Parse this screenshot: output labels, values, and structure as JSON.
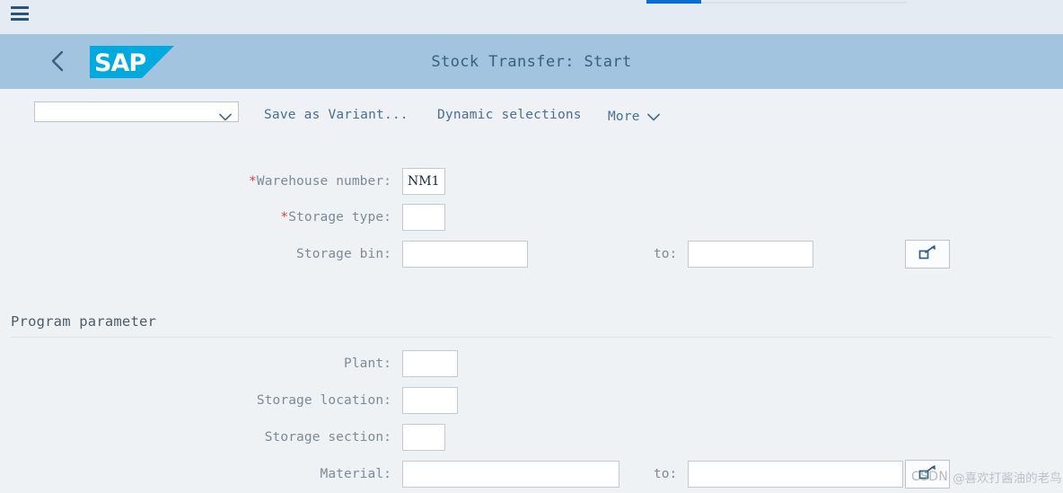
{
  "shell": {
    "menu_icon": "hamburger-menu-icon",
    "back_icon": "chevron-left-icon",
    "logo_text": "SAP",
    "title": "Stock Transfer: Start",
    "header_color": "#a3c4de",
    "accent_color": "#0a6ed1"
  },
  "toolbar": {
    "variant_value": "",
    "variant_placeholder": "",
    "variant_chevron_icon": "chevron-down-icon",
    "save_as_variant_label": "Save as Variant...",
    "dynamic_selections_label": "Dynamic selections",
    "more_label": "More",
    "more_chevron_icon": "chevron-down-icon"
  },
  "form": {
    "required_marker": "*",
    "to_label": "to:",
    "multi_select_icon": "multi-selection-arrow-icon",
    "selection_fields": [
      {
        "label": "Warehouse number:",
        "required": true,
        "value": "NM1",
        "placeholder": ""
      },
      {
        "label": "Storage type:",
        "required": true,
        "value": "",
        "placeholder": ""
      },
      {
        "label": "Storage bin:",
        "required": false,
        "value": "",
        "placeholder": "",
        "to_value": ""
      }
    ],
    "section_title": "Program parameter",
    "program_fields": [
      {
        "label": "Plant:",
        "value": "",
        "placeholder": ""
      },
      {
        "label": "Storage location:",
        "value": "",
        "placeholder": ""
      },
      {
        "label": "Storage section:",
        "value": "",
        "placeholder": ""
      },
      {
        "label": "Material:",
        "value": "",
        "placeholder": "",
        "to_value": ""
      }
    ]
  },
  "watermark": {
    "site": "CSDN",
    "user": "@喜欢打酱油的老鸟"
  }
}
